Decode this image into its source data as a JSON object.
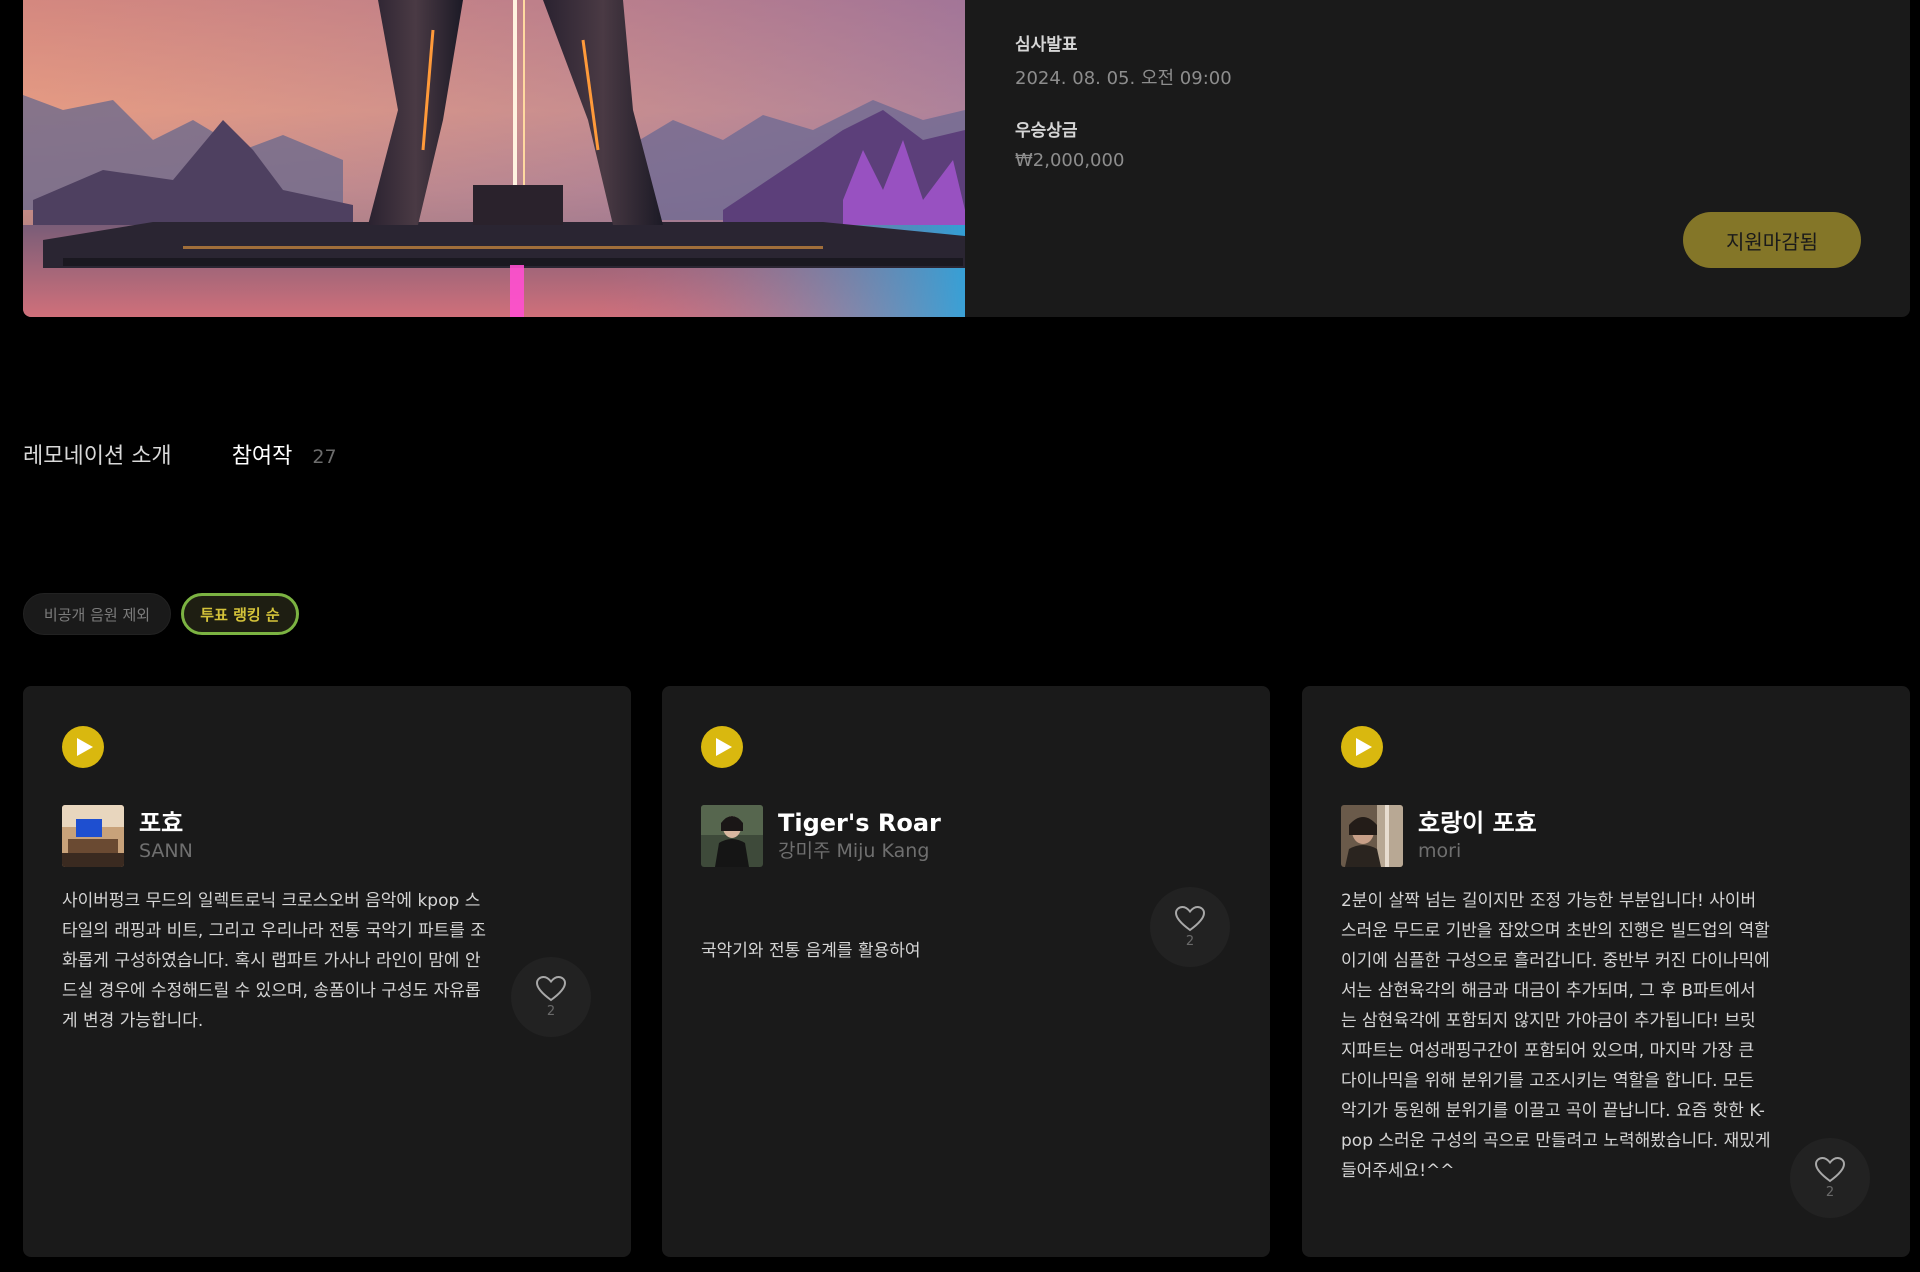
{
  "hero": {
    "info": [
      {
        "label": "심사발표",
        "value": "2024. 08. 05. 오전 09:00"
      },
      {
        "label": "우승상금",
        "value": "₩2,000,000"
      }
    ],
    "status_button": "지원마감됨",
    "colors": {
      "button": "#847628",
      "panel": "#1a1a1a"
    }
  },
  "tabs": {
    "intro_label": "레모네이션 소개",
    "participants_label": "참여작",
    "participants_count": "27"
  },
  "filters": {
    "private_label": "비공개 음원 제외",
    "vote_label": "투표 랭킹 순"
  },
  "cards": [
    {
      "title": "포효",
      "artist": "SANN",
      "description": "사이버펑크 무드의 일렉트로닉 크로스오버 음악에 kpop 스타일의 래핑과 비트, 그리고 우리나라 전통 국악기 파트를 조화롭게 구성하였습니다. 혹시 랩파트 가사나 라인이 맘에 안드실 경우에 수정해드릴 수 있으며, 송폼이나 구성도 자유롭게 변경 가능합니다.",
      "likes": "2",
      "play_icon": "play-icon",
      "like_icon": "heart-icon"
    },
    {
      "title": "Tiger's Roar",
      "artist": "강미주 Miju Kang",
      "description": "국악기와 전통 음계를 활용하여",
      "likes": "2",
      "play_icon": "play-icon",
      "like_icon": "heart-icon"
    },
    {
      "title": "호랑이 포효",
      "artist": "mori",
      "description": "2분이 살짝 넘는 길이지만 조정 가능한 부분입니다! 사이버스러운 무드로 기반을 잡았으며 초반의 진행은 빌드업의 역할이기에 심플한 구성으로 흘러갑니다. 중반부 커진 다이나믹에서는 삼현육각의 해금과 대금이 추가되며, 그 후 B파트에서는 삼현육각에 포함되지 않지만 가야금이 추가됩니다! 브릿지파트는 여성래핑구간이 포함되어 있으며, 마지막 가장 큰 다이나믹을 위해 분위기를 고조시키는 역할을 합니다. 모든 악기가 동원해 분위기를 이끌고 곡이 끝납니다. 요즘 핫한 K-pop 스러운 구성의 곡으로 만들려고 노력해봤습니다. 재밌게 들어주세요!^^",
      "likes": "2",
      "play_icon": "play-icon",
      "like_icon": "heart-icon"
    }
  ],
  "accent_color": "#d9b80f"
}
